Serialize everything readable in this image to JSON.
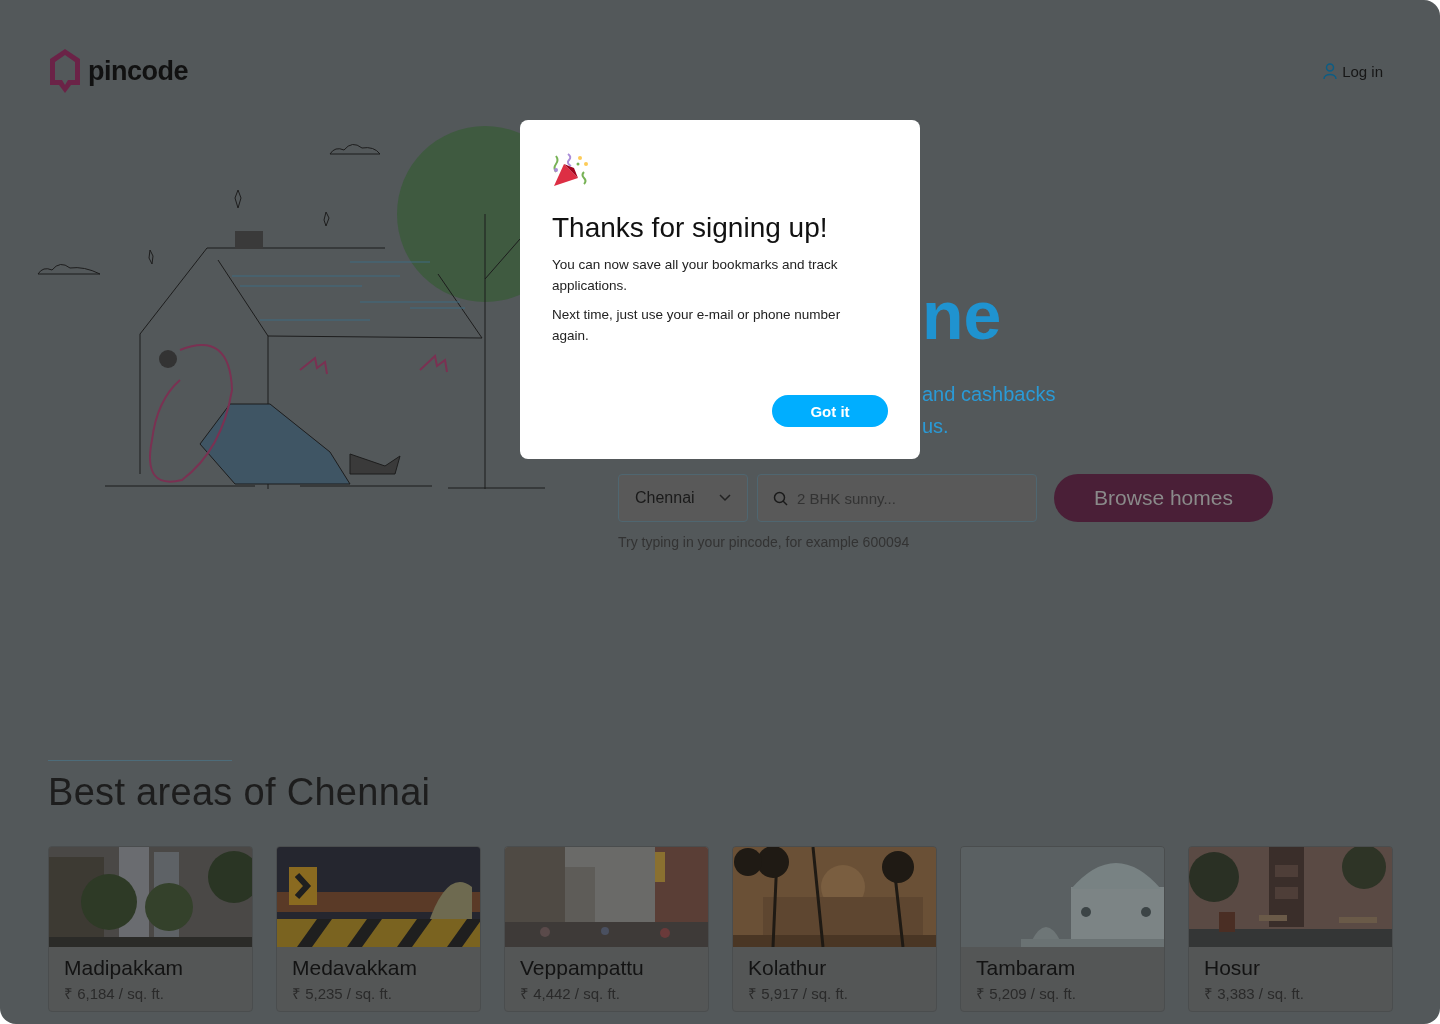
{
  "header": {
    "logo": "pincode",
    "login": "Log in"
  },
  "hero": {
    "headline_fragment": "ne",
    "tagline_fragments": [
      "and cashbacks",
      "us."
    ],
    "city_select": {
      "value": "Chennai"
    },
    "search": {
      "placeholder": "2 BHK sunny..."
    },
    "button": "Browse homes",
    "hint": "Try typing in your pincode, for example 600094"
  },
  "areas": {
    "title": "Best areas of Chennai",
    "cards": [
      {
        "name": "Madipakkam",
        "price": "₹ 6,184 / sq. ft."
      },
      {
        "name": "Medavakkam",
        "price": "₹ 5,235 / sq. ft."
      },
      {
        "name": "Veppampattu",
        "price": "₹ 4,442 / sq. ft."
      },
      {
        "name": "Kolathur",
        "price": "₹ 5,917 / sq. ft."
      },
      {
        "name": "Tambaram",
        "price": "₹ 5,209 / sq. ft."
      },
      {
        "name": "Hosur",
        "price": "₹ 3,383 / sq. ft."
      }
    ]
  },
  "modal": {
    "title": "Thanks for signing up!",
    "paragraphs": [
      "You can now save all your bookmarks and track applications.",
      "Next time, just use your e-mail or phone number again."
    ],
    "button": "Got it"
  }
}
